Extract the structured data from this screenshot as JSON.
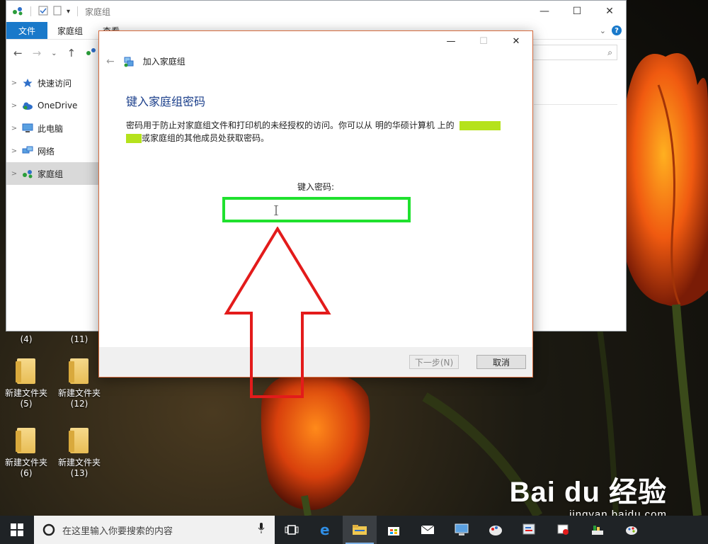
{
  "explorer": {
    "title": "家庭组",
    "ribbon_tabs": [
      "文件",
      "家庭组",
      "查看"
    ],
    "nav_items": [
      {
        "label": "快速访问",
        "icon": "star-icon"
      },
      {
        "label": "OneDrive",
        "icon": "cloud-icon"
      },
      {
        "label": "此电脑",
        "icon": "computer-icon"
      },
      {
        "label": "网络",
        "icon": "network-icon"
      },
      {
        "label": "家庭组",
        "icon": "homegroup-icon",
        "selected": true
      }
    ]
  },
  "dialog": {
    "title": "加入家庭组",
    "heading": "键入家庭组密码",
    "desc_part1": "密码用于防止对家庭组文件和打印机的未经授权的访问。你可以从 明的华硕计算机 上的",
    "desc_part2": "或家庭组的其他成员处获取密码。",
    "password_label": "键入密码:",
    "password_value": "",
    "next_button": "下一步(N)",
    "cancel_button": "取消"
  },
  "desktop_icons": [
    {
      "label": "",
      "count": "(4)"
    },
    {
      "label": "",
      "count": "(11)"
    },
    {
      "label": "新建文件夹",
      "count": "(5)"
    },
    {
      "label": "新建文件夹",
      "count": "(12)"
    },
    {
      "label": "新建文件夹",
      "count": "(6)"
    },
    {
      "label": "新建文件夹",
      "count": "(13)"
    }
  ],
  "taskbar": {
    "search_placeholder": "在这里输入你要搜索的内容"
  },
  "watermark": {
    "brand": "Bai du 经验",
    "url": "jingyan.baidu.com"
  },
  "colors": {
    "accent": "#1979ca",
    "highlight": "#b5e21c",
    "input_border": "#1fe12e",
    "annotation": "#e31b1b"
  }
}
